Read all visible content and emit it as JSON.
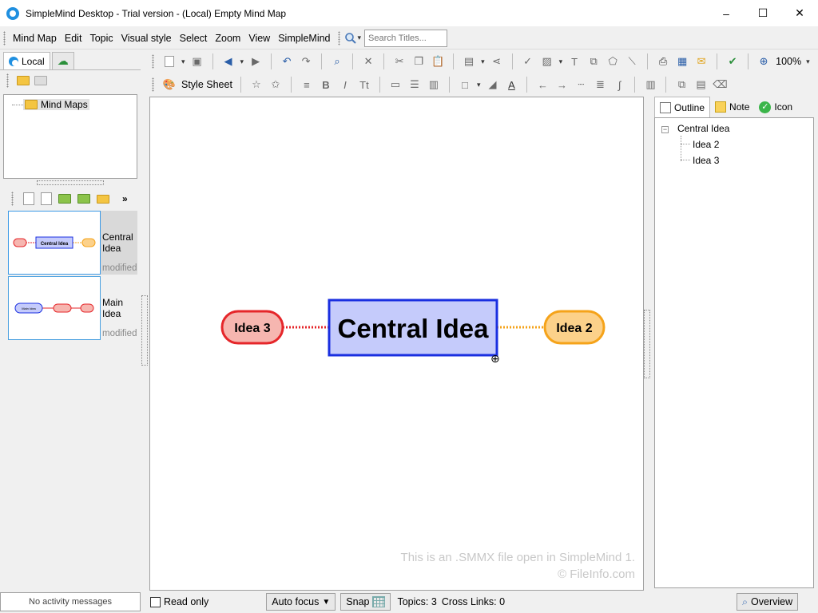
{
  "window": {
    "title": "SimpleMind Desktop - Trial version - (Local) Empty Mind Map",
    "controls": [
      "–",
      "☐",
      "✕"
    ]
  },
  "menu": {
    "items": [
      "Mind Map",
      "Edit",
      "Topic",
      "Visual style",
      "Select",
      "Zoom",
      "View",
      "SimpleMind"
    ],
    "search_placeholder": "Search Titles..."
  },
  "left_panel": {
    "tabs": [
      "Local"
    ],
    "tree_root": "Mind Maps",
    "documents": [
      {
        "title": "Central Idea",
        "status": "modified",
        "thumb_labels": [
          "Central Idea"
        ]
      },
      {
        "title": "Main Idea",
        "status": "modified",
        "thumb_labels": [
          "Main Idea"
        ]
      }
    ]
  },
  "toolbar": {
    "zoom": "100%",
    "style_sheet_label": "Style Sheet"
  },
  "canvas": {
    "central_topic": "Central Idea",
    "left_topic": "Idea 3",
    "right_topic": "Idea 2",
    "watermark_line1": "This is an .SMMX file open in SimpleMind 1.",
    "watermark_line2": "© FileInfo.com",
    "colors": {
      "central_fill": "#c5cbfb",
      "central_border": "#1a2fe0",
      "left_fill": "#f6b6b0",
      "left_border": "#e5262a",
      "right_fill": "#fcd18a",
      "right_border": "#f5a31a"
    }
  },
  "right_panel": {
    "tabs": [
      "Outline",
      "Note",
      "Icon"
    ],
    "outline": {
      "root": "Central Idea",
      "children": [
        "Idea 2",
        "Idea 3"
      ]
    }
  },
  "status": {
    "message": "No activity messages",
    "read_only": "Read only",
    "auto_focus": "Auto focus",
    "snap": "Snap",
    "topics": "Topics: 3",
    "cross_links": "Cross Links: 0",
    "overview": "Overview"
  }
}
